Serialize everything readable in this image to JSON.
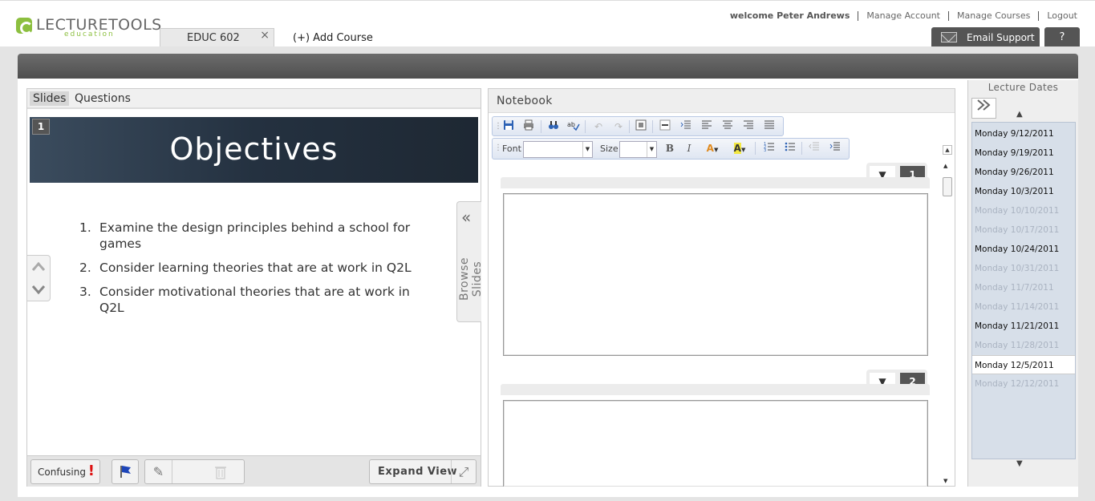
{
  "app": {
    "logo_main": "LECTURETOOLS",
    "logo_sub": "education"
  },
  "header": {
    "welcome": "welcome Peter Andrews",
    "links": [
      "Manage Account",
      "Manage Courses",
      "Logout"
    ],
    "course_tab": "EDUC 602",
    "course_tab_close": "×",
    "add_course": "(+) Add Course",
    "email_support": "Email Support",
    "help": "?"
  },
  "slides": {
    "tabs": [
      "Slides",
      "Questions"
    ],
    "slide_number": "1",
    "slide_title": "Objectives",
    "objectives": [
      {
        "n": "1.",
        "text": "Examine the design principles behind a school for games"
      },
      {
        "n": "2.",
        "text": "Consider learning theories that are at work in Q2L"
      },
      {
        "n": "3.",
        "text": "Consider motivational theories that are at work in Q2L"
      }
    ],
    "browse_label": "Browse Slides",
    "toolbar": {
      "confusing": "Confusing",
      "expand_view": "Expand View"
    }
  },
  "notebook": {
    "title": "Notebook",
    "font_label": "Font",
    "size_label": "Size",
    "bold": "B",
    "italic": "I",
    "text_color": "A",
    "highlight": "A",
    "notes": [
      {
        "number": "1"
      },
      {
        "number": "2"
      }
    ]
  },
  "lecture_dates": {
    "title": "Lecture Dates",
    "dates": [
      {
        "label": "Monday 9/12/2011",
        "state": "normal"
      },
      {
        "label": "Monday 9/19/2011",
        "state": "normal"
      },
      {
        "label": "Monday 9/26/2011",
        "state": "normal"
      },
      {
        "label": "Monday 10/3/2011",
        "state": "normal"
      },
      {
        "label": "Monday 10/10/2011",
        "state": "disabled"
      },
      {
        "label": "Monday 10/17/2011",
        "state": "disabled"
      },
      {
        "label": "Monday 10/24/2011",
        "state": "normal"
      },
      {
        "label": "Monday 10/31/2011",
        "state": "disabled"
      },
      {
        "label": "Monday 11/7/2011",
        "state": "disabled"
      },
      {
        "label": "Monday 11/14/2011",
        "state": "disabled"
      },
      {
        "label": "Monday 11/21/2011",
        "state": "normal"
      },
      {
        "label": "Monday 11/28/2011",
        "state": "disabled"
      },
      {
        "label": "Monday 12/5/2011",
        "state": "selected"
      },
      {
        "label": "Monday 12/12/2011",
        "state": "disabled"
      }
    ]
  },
  "colors": {
    "brand_green": "#8cbf3f",
    "dark_bar": "#555555",
    "slide_header_bg": "#243140",
    "confusing_red": "#dd1111",
    "flag_blue": "#1d45b8",
    "dates_panel_bg": "#d7dfe9"
  },
  "icons": {
    "logo": "lecturetools-logo-icon",
    "email": "envelope-icon",
    "flag": "flag-icon",
    "pencil": "pencil-icon",
    "trash": "trash-icon",
    "expand": "expand-icon",
    "dates_expand": "double-chevron-right-icon"
  }
}
